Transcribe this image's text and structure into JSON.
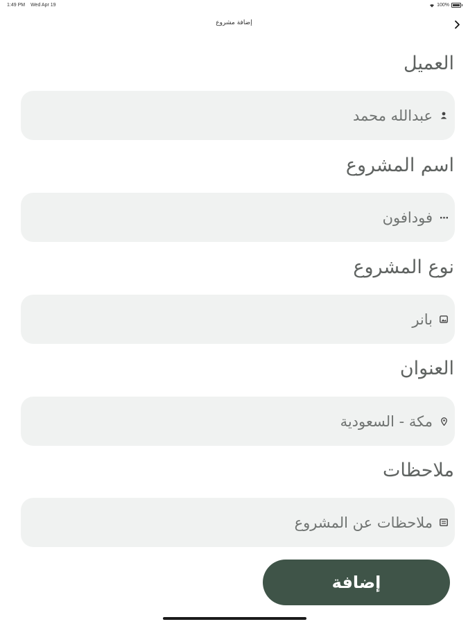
{
  "status_bar": {
    "time": "1:49 PM",
    "date": "Wed Apr 19",
    "battery": "100%"
  },
  "nav": {
    "title": "إضافة مشروع",
    "back_icon": "chevron-right-icon"
  },
  "form": {
    "client": {
      "label": "العميل",
      "value": "عبدالله محمد",
      "icon": "person-icon"
    },
    "project_name": {
      "label": "اسم المشروع",
      "value": "فودافون",
      "icon": "dots-icon"
    },
    "project_type": {
      "label": "نوع المشروع",
      "value": "بانر",
      "icon": "image-icon"
    },
    "address": {
      "label": "العنوان",
      "value": "مكة - السعودية",
      "icon": "location-pin-icon"
    },
    "notes": {
      "label": "ملاحظات",
      "value": "ملاحظات عن المشروع",
      "icon": "note-icon"
    }
  },
  "submit_label": "إضافة",
  "colors": {
    "primary": "#3f5448",
    "field_background": "#f0f2f1",
    "label": "#5f6361"
  }
}
